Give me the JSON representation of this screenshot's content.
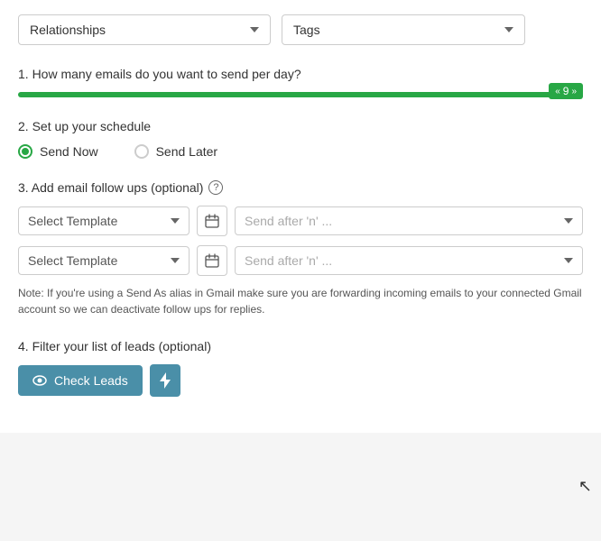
{
  "header": {
    "relationships_label": "Relationships",
    "tags_label": "Tags"
  },
  "section1": {
    "label": "1. How many emails do you want to send per day?",
    "slider_value": "9",
    "slider_badge": "« 9 »"
  },
  "section2": {
    "label": "2. Set up your schedule",
    "send_now_label": "Send Now",
    "send_later_label": "Send Later",
    "send_now_selected": true
  },
  "section3": {
    "label": "3. Add email follow ups (optional)",
    "row1": {
      "template_placeholder": "Select Template",
      "send_after_placeholder": "Send after 'n' ..."
    },
    "row2": {
      "template_placeholder": "Select Template",
      "send_after_placeholder": "Send after 'n' ..."
    },
    "note": "Note: If you're using a Send As alias in Gmail make sure you are forwarding incoming emails to your connected Gmail account so we can deactivate follow ups for replies."
  },
  "section4": {
    "label": "4. Filter your list of leads (optional)",
    "check_leads_label": "Check Leads"
  },
  "icons": {
    "chevron": "▾",
    "calendar": "📅",
    "eye": "👁",
    "lightning": "⚡"
  }
}
